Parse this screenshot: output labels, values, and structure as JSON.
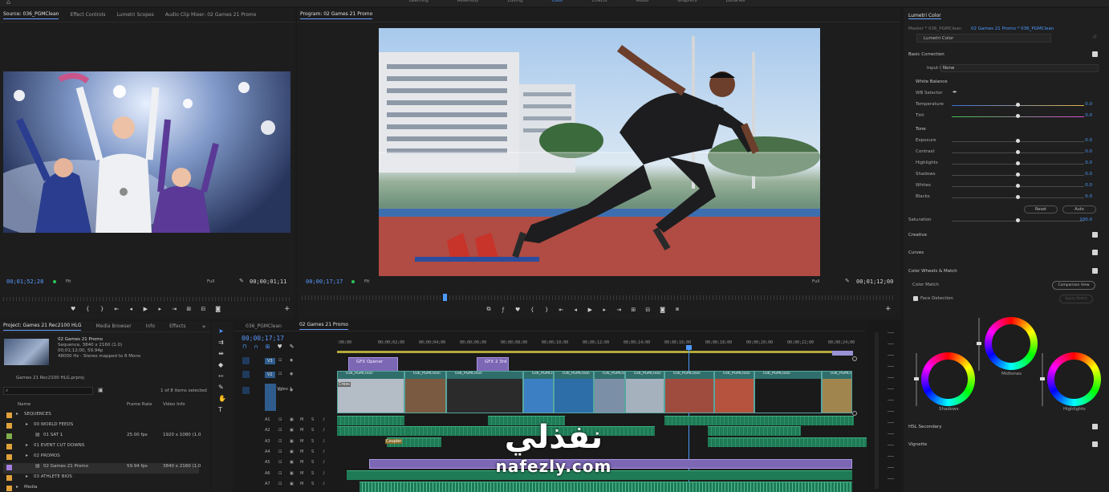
{
  "top_menu": [
    "Learning",
    "Assembly",
    "Editing",
    "Color",
    "Effects",
    "Audio",
    "Graphics",
    "Libraries"
  ],
  "source_panel": {
    "tabs": [
      "Source: 036_PGMClean",
      "Effect Controls",
      "Lumetri Scopes",
      "Audio Clip Mixer: 02 Games 21 Promo"
    ],
    "timecode": "00;01;52;28",
    "fit": "Fit",
    "quality": "Full",
    "duration": "00;00;01;11"
  },
  "program_panel": {
    "tab": "Program: 02 Games 21 Promo",
    "timecode": "00;00;17;17",
    "fit": "Fit",
    "quality": "Full",
    "duration": "00;01;12;00"
  },
  "lumetri": {
    "title": "Lumetri Color",
    "master_path": "Master * 036_PGMClean",
    "sequence_path": "02 Games 21 Promo * 036_PGMClean",
    "dropdown": "Lumetri Color",
    "basic_correction": "Basic Correction",
    "input_lut_label": "Input LUT",
    "input_lut_value": "None",
    "white_balance": "White Balance",
    "wb_selector": "WB Selector",
    "temperature": {
      "label": "Temperature",
      "value": "0.0",
      "level": 0.5
    },
    "tint": {
      "label": "Tint",
      "value": "0.0",
      "level": 0.5
    },
    "tone": "Tone",
    "exposure": {
      "label": "Exposure",
      "value": "0.0",
      "level": 0.5
    },
    "contrast": {
      "label": "Contrast",
      "value": "0.0",
      "level": 0.5
    },
    "highlights": {
      "label": "Highlights",
      "value": "0.0",
      "level": 0.5
    },
    "shadows": {
      "label": "Shadows",
      "value": "0.0",
      "level": 0.5
    },
    "whites": {
      "label": "Whites",
      "value": "0.0",
      "level": 0.5
    },
    "blacks": {
      "label": "Blacks",
      "value": "0.0",
      "level": 0.5
    },
    "reset": "Reset",
    "auto": "Auto",
    "saturation": {
      "label": "Saturation",
      "value": "100.0",
      "level": 0.5
    },
    "creative": "Creative",
    "curves": "Curves",
    "color_wheels": "Color Wheels & Match",
    "color_match": "Color Match",
    "comparison_view": "Comparison View",
    "face_detection": "Face Detection",
    "apply_match": "Apply Match",
    "midtones": "Midtones",
    "shadows_wheel": "Shadows",
    "highlights_wheel": "Highlights",
    "hsl_secondary": "HSL Secondary",
    "vignette": "Vignette"
  },
  "project_panel": {
    "tabs": [
      "Project: Games 21 Rec2100 HLG",
      "Media Browser",
      "Info",
      "Effects"
    ],
    "clip_name": "02 Games 21 Promo",
    "clip_info1": "Sequence, 3840 x 2160 (1.0)",
    "clip_info2": "00;01;12;00, 59.94p",
    "clip_info3": "48000 Hz - Stereo mapped to 8 Mono",
    "project_file": "Games 21 Rec2100 HLG.prproj",
    "items_selected": "1 of 8 items selected",
    "columns": [
      "Name",
      "Frame Rate",
      "Video Info"
    ],
    "rows": [
      {
        "name": "SEQUENCES",
        "rate": "",
        "info": ""
      },
      {
        "name": "00 WORLD FEEDS",
        "rate": "",
        "info": ""
      },
      {
        "name": "01 SAT 1",
        "rate": "25.00 fps",
        "info": "1920 x 1080 (1.0"
      },
      {
        "name": "01 EVENT CUT DOWNS",
        "rate": "",
        "info": ""
      },
      {
        "name": "02 PROMOS",
        "rate": "",
        "info": ""
      },
      {
        "name": "02 Games 21 Promo",
        "rate": "59.94 fps",
        "info": "3840 x 2160 (1.0"
      },
      {
        "name": "03 ATHLETE BIOS",
        "rate": "",
        "info": ""
      },
      {
        "name": "Media",
        "rate": "",
        "info": ""
      }
    ]
  },
  "timeline": {
    "tabs": [
      "036_PGMClean",
      "02 Games 21 Promo"
    ],
    "timecode": "00;00;17;17",
    "ruler": [
      ":00;00",
      "00;00;02;00",
      "00;00;04;00",
      "00;00;06;00",
      "00;00;08;00",
      "00;00;10;00",
      "00;00;12;00",
      "00;00;14;00",
      "00;00;16;00",
      "00;00;18;00",
      "00;00;20;00",
      "00;00;22;00",
      "00;00;24;00"
    ],
    "gfx1": "GFX Opener",
    "gfx2": "GFX 2 3rd",
    "clip_label": "036_PGMClean",
    "cross": "Cross",
    "coupler": "Coupler",
    "video_tracks": [
      "V3",
      "V2",
      "V1"
    ],
    "audio_tracks": [
      "A1",
      "A2",
      "A3",
      "A4",
      "A5",
      "A6",
      "A7"
    ],
    "video1": "Video 1"
  },
  "watermark": {
    "arabic": "نفذلي",
    "latin": "nafezly.com"
  },
  "colors": {
    "accent": "#4d9aff",
    "vclip": "#2f6e6b",
    "aclip": "#1f7a56",
    "pclip": "#7c67b5"
  }
}
